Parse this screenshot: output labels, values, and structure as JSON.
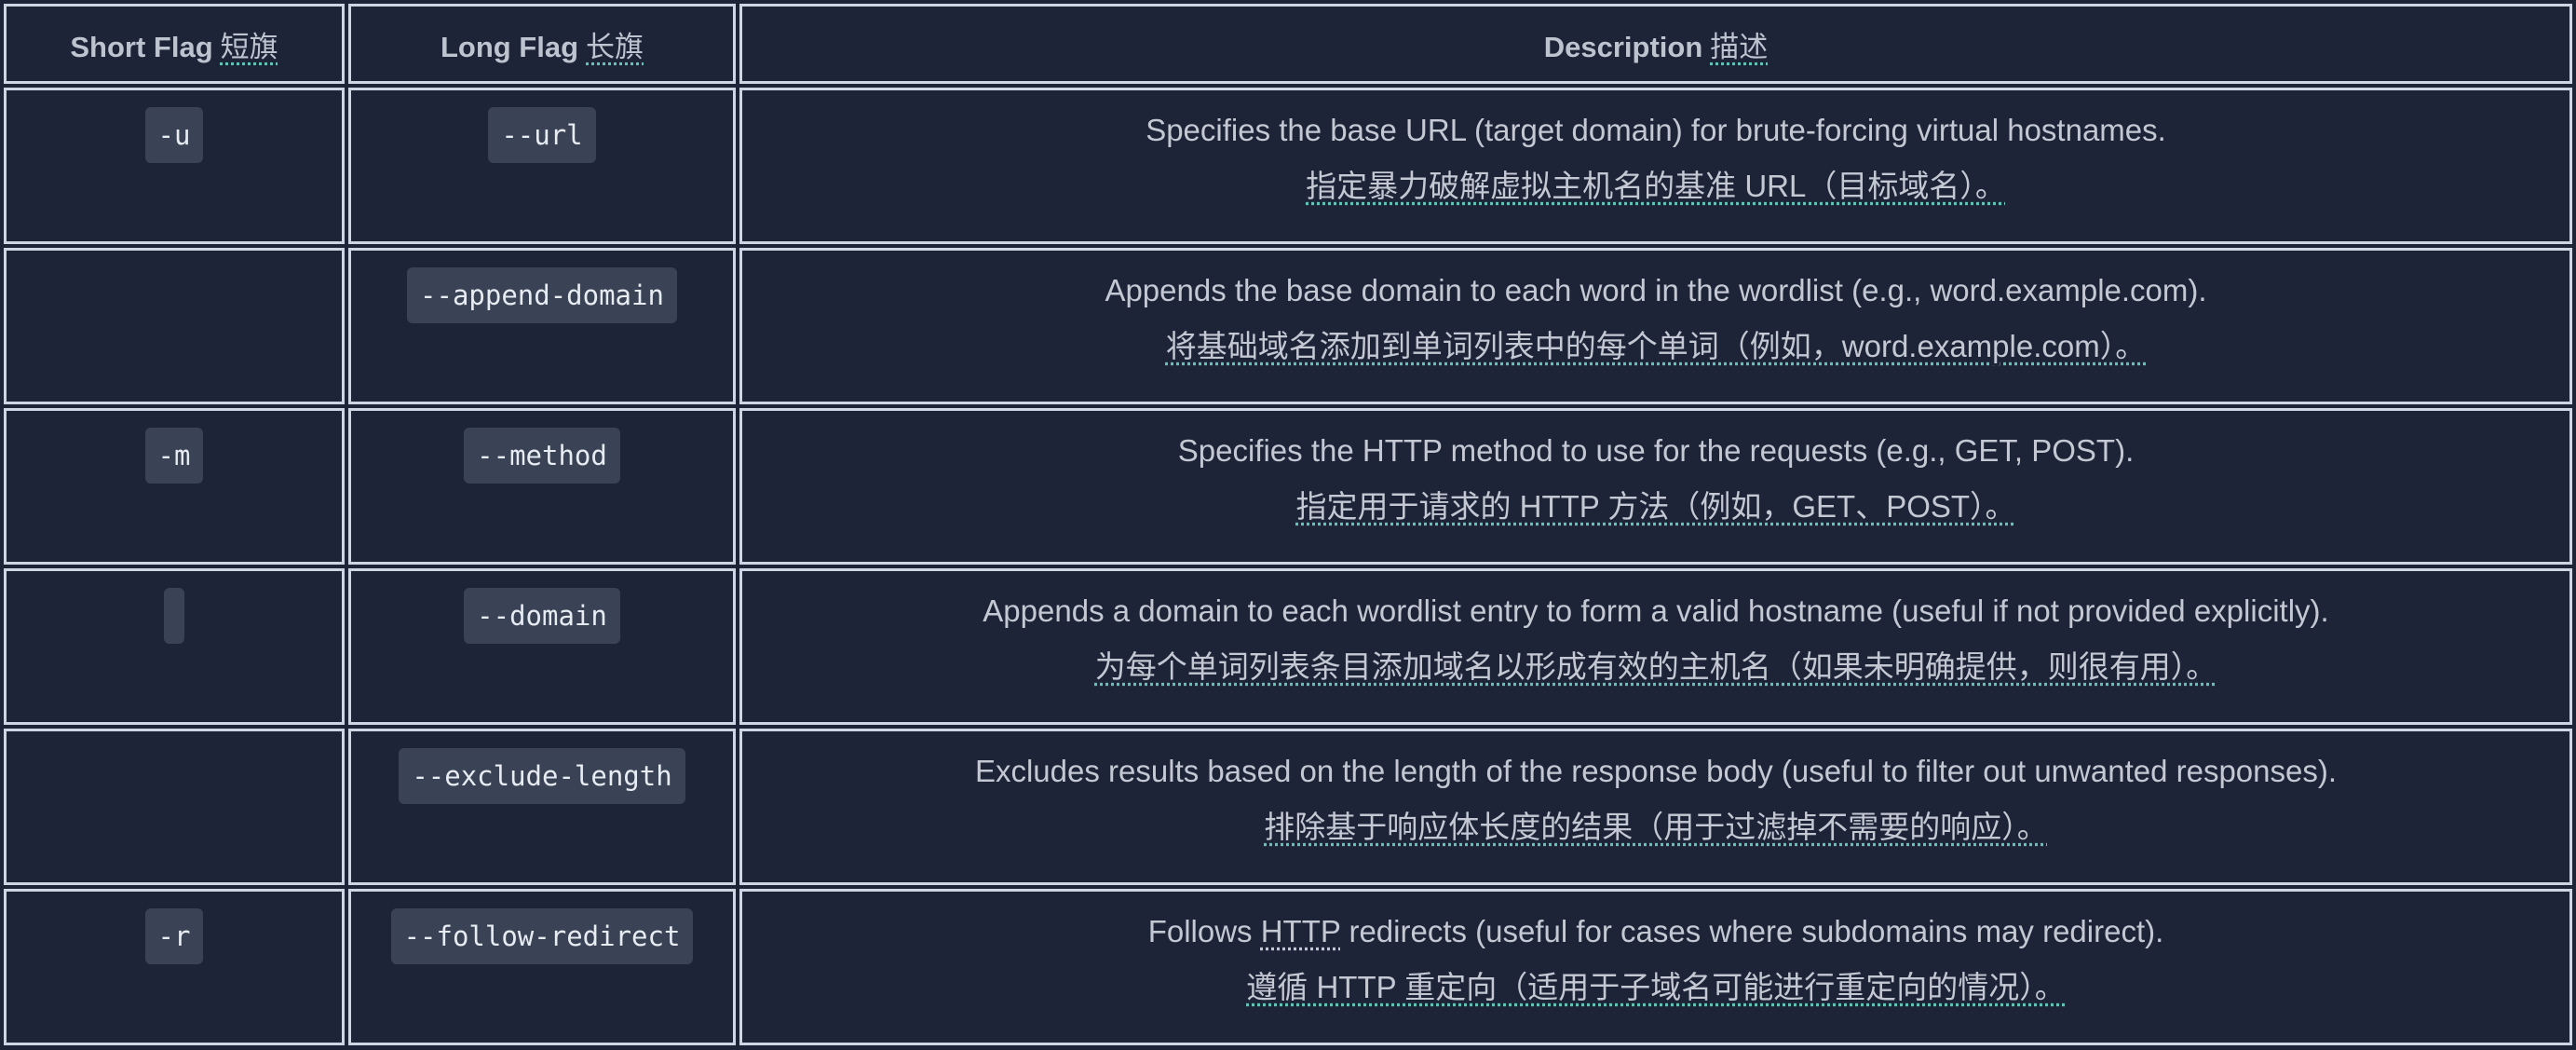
{
  "headers": {
    "short_en": "Short Flag",
    "short_zh": "短旗",
    "long_en": "Long Flag",
    "long_zh": "长旗",
    "desc_en": "Description",
    "desc_zh": "描述"
  },
  "rows": [
    {
      "short": "-u",
      "long": "--url",
      "en": "Specifies the base URL (target domain) for brute-forcing virtual hostnames.",
      "zh": "指定暴力破解虚拟主机名的基准 URL（目标域名）。"
    },
    {
      "short": "",
      "long": "--append-domain",
      "en": "Appends the base domain to each word in the wordlist (e.g., word.example.com).",
      "zh": "将基础域名添加到单词列表中的每个单词（例如，word.example.com）。"
    },
    {
      "short": "-m",
      "long": "--method",
      "en": "Specifies the HTTP method to use for the requests (e.g., GET, POST).",
      "zh": "指定用于请求的 HTTP 方法（例如，GET、POST）。"
    },
    {
      "short": "",
      "long": "--domain",
      "en": "Appends a domain to each wordlist entry to form a valid hostname (useful if not provided explicitly).",
      "zh": "为每个单词列表条目添加域名以形成有效的主机名（如果未明确提供，则很有用）。"
    },
    {
      "short": "",
      "long": "--exclude-length",
      "en": "Excludes results based on the length of the response body (useful to filter out unwanted responses).",
      "zh": "排除基于响应体长度的结果（用于过滤掉不需要的响应）。"
    },
    {
      "short": "-r",
      "long": "--follow-redirect",
      "en_before": "Follows ",
      "en_abbr": "HTTP",
      "en_after": " redirects (useful for cases where subdomains may redirect).",
      "zh": "遵循 HTTP 重定向（适用于子域名可能进行重定向的情况）。"
    }
  ]
}
